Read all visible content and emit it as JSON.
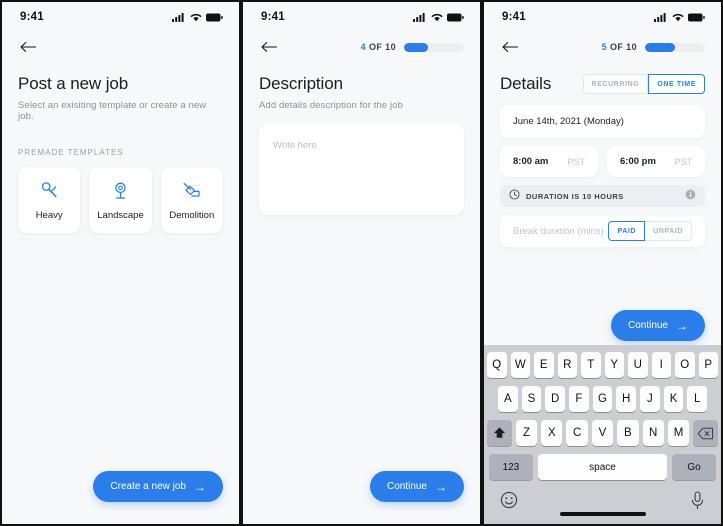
{
  "accent": "#2b7de9",
  "status_bar": {
    "time": "9:41",
    "icons": [
      "cellular-signal-icon",
      "wifi-icon",
      "battery-icon"
    ]
  },
  "panel1": {
    "back_icon": "back-arrow-icon",
    "title": "Post a new job",
    "subtitle": "Select an exisiting template or create a new job.",
    "section_label": "PREMADE TEMPLATES",
    "templates": [
      {
        "label": "Heavy",
        "icon": "hammer-icon"
      },
      {
        "label": "Landscape",
        "icon": "tree-icon"
      },
      {
        "label": "Demolition",
        "icon": "excavator-icon"
      }
    ],
    "cta": {
      "label": "Create a new job",
      "arrow": "→"
    }
  },
  "panel2": {
    "back_icon": "back-arrow-icon",
    "step": {
      "current": "4",
      "of_text": "OF 10",
      "percent": 40
    },
    "title": "Description",
    "subtitle": "Add details description for the job",
    "textarea": {
      "placeholder": "Write here",
      "value": ""
    },
    "cta": {
      "label": "Continue",
      "arrow": "→"
    }
  },
  "panel3": {
    "back_icon": "back-arrow-icon",
    "step": {
      "current": "5",
      "of_text": "OF 10",
      "percent": 50
    },
    "title": "Details",
    "segments": [
      {
        "label": "RECURRING",
        "active": false
      },
      {
        "label": "ONE TIME",
        "active": true
      }
    ],
    "date_field": {
      "value": "June 14th, 2021 (Monday)"
    },
    "start_time": {
      "value": "8:00 am",
      "timezone": "PST"
    },
    "end_time": {
      "value": "6:00 pm",
      "timezone": "PST"
    },
    "duration": {
      "icon": "clock-icon",
      "text": "DURATION IS 10 HOURS",
      "info_icon": "info-icon"
    },
    "break_field": {
      "placeholder": "Break duration (mins)",
      "value": "",
      "options": [
        {
          "label": "PAID",
          "active": true
        },
        {
          "label": "UNPAID",
          "active": false
        }
      ]
    },
    "cta": {
      "label": "Continue",
      "arrow": "→"
    },
    "keyboard": {
      "row1": [
        "Q",
        "W",
        "E",
        "R",
        "T",
        "Y",
        "U",
        "I",
        "O",
        "P"
      ],
      "row2": [
        "A",
        "S",
        "D",
        "F",
        "G",
        "H",
        "J",
        "K",
        "L"
      ],
      "row3": [
        "Z",
        "X",
        "C",
        "V",
        "B",
        "N",
        "M"
      ],
      "shift_icon": "shift-icon",
      "backspace_icon": "backspace-icon",
      "numbers_label": "123",
      "space_label": "space",
      "go_label": "Go",
      "emoji_icon": "emoji-icon",
      "mic_icon": "microphone-icon"
    }
  }
}
